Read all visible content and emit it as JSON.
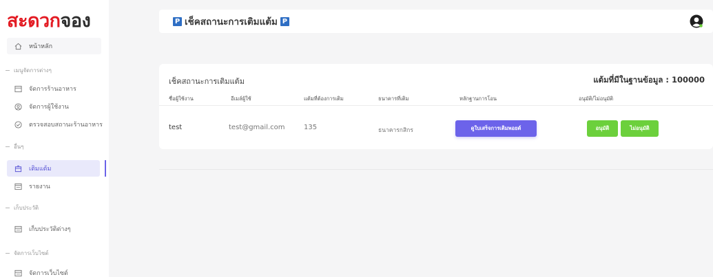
{
  "brand": {
    "logo_red": "สะดวก",
    "logo_dark": "จอง"
  },
  "sidebar": {
    "home": {
      "label": "หน้าหลัก",
      "icon": "home-icon"
    },
    "sections": [
      {
        "label": "เมนูจัดการต่างๆ"
      },
      {
        "label": "อื่นๆ"
      },
      {
        "label": "เก็บประวัติ"
      },
      {
        "label": "จัดการเว็บไซต์"
      }
    ],
    "items": [
      {
        "label": "จัดการร้านอาหาร",
        "icon": "table-icon"
      },
      {
        "label": "จัดการผู้ใช้งาน",
        "icon": "user-icon"
      },
      {
        "label": "ตรวจสอบสถานะร้านอาหาร",
        "icon": "check-circle-icon"
      },
      {
        "label": "เติมแต้ม",
        "icon": "box-icon"
      },
      {
        "label": "รายงาน",
        "icon": "report-icon"
      },
      {
        "label": "เก็บประวัติต่างๆ",
        "icon": "table-icon"
      },
      {
        "label": "จัดการเว็บไซต์",
        "icon": "table-icon"
      }
    ]
  },
  "topbar": {
    "title": "เช็คสถานะการเติมแต้ม",
    "badge": "P"
  },
  "card": {
    "title": "เช็คสถานะการเติมแต้ม",
    "count_label": "แต้มที่มีในฐานข้อมูล : 100000",
    "headers": [
      "ชื่อผู้ใช้งาน",
      "อีเมล์ผู้ใช้",
      "แต้มที่ต้องการเติม",
      "ธนาคารที่เติม",
      "หลักฐานการโอน",
      "อนุมัติ/ไม่อนุมัติ"
    ],
    "rows": [
      {
        "username": "test",
        "email": "test@gmail.com",
        "points": "135",
        "bank": "ธนาคารกสิกร",
        "slip_button": "ดูใบเสร็จการเติมพอยต์",
        "approve_button": "อนุมัติ",
        "reject_button": "ไม่อนุมัติ"
      }
    ]
  },
  "colors": {
    "brand_red": "#e31b23",
    "accent": "#6c63ea",
    "approve_green": "#6cd03c",
    "badge_blue": "#2e6ec4"
  }
}
